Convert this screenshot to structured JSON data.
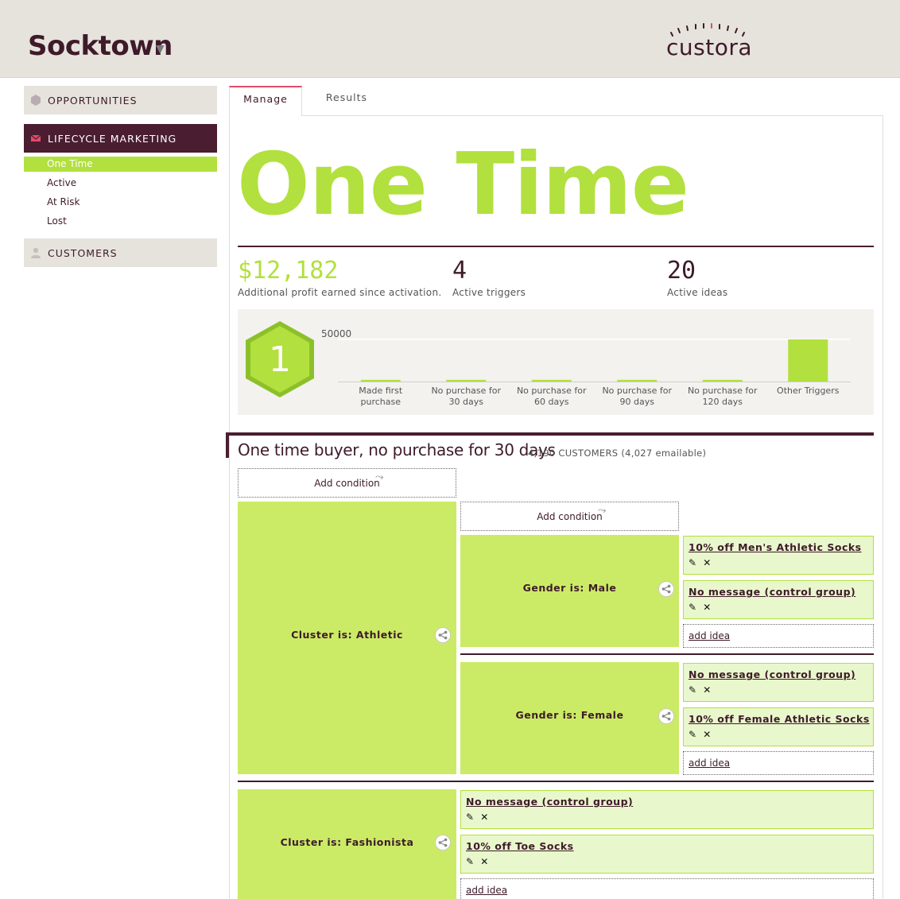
{
  "header": {
    "brand": "Socktown",
    "brand_caret": "▼",
    "logo_text": "custora",
    "logo_accent_color": "#e24b6a"
  },
  "sidebar": {
    "sections": [
      {
        "label": "OPPORTUNITIES",
        "icon": "hexagon-icon"
      },
      {
        "label": "LIFECYCLE MARKETING",
        "icon": "envelope-icon"
      },
      {
        "label": "CUSTOMERS",
        "icon": "person-icon"
      }
    ],
    "lifecycle_items": [
      {
        "label": "One Time",
        "active": true
      },
      {
        "label": "Active",
        "active": false
      },
      {
        "label": "At Risk",
        "active": false
      },
      {
        "label": "Lost",
        "active": false
      }
    ]
  },
  "tabs": [
    {
      "label": "Manage",
      "active": true
    },
    {
      "label": "Results",
      "active": false
    }
  ],
  "page_title": "One Time",
  "stats": [
    {
      "value": "$12,182",
      "label": "Additional profit earned since activation."
    },
    {
      "value": "4",
      "label": "Active triggers"
    },
    {
      "value": "20",
      "label": "Active ideas"
    }
  ],
  "badge_number": "1",
  "chart_data": {
    "type": "bar",
    "categories": [
      "Made first purchase",
      "No purchase for 30 days",
      "No purchase for 60 days",
      "No purchase for 90 days",
      "No purchase for 120 days",
      "Other Triggers"
    ],
    "values": [
      2000,
      2000,
      2000,
      2000,
      2000,
      50000
    ],
    "y_tick_label": "50000",
    "ylim": [
      0,
      52000
    ],
    "bar_color": "#b2e03e",
    "grid": true
  },
  "segment": {
    "title": "One time buyer, no purchase for 30 days",
    "subtitle": "4,190 CUSTOMERS (4,027 emailable)",
    "add_condition_label": "Add condition",
    "add_idea_label": "add idea",
    "idea_actions": "✎ ✕",
    "clusters": [
      {
        "label": "Cluster is: Athletic",
        "subgroups": [
          {
            "label": "Gender is: Male",
            "ideas": [
              "10% off Men's Athletic Socks",
              "No message (control group)"
            ]
          },
          {
            "label": "Gender is: Female",
            "ideas": [
              "No message (control group)",
              "10% off Female Athletic Socks"
            ]
          }
        ]
      },
      {
        "label": "Cluster is: Fashionista",
        "ideas": [
          "No message (control group)",
          "10% off Toe Socks"
        ]
      }
    ]
  }
}
